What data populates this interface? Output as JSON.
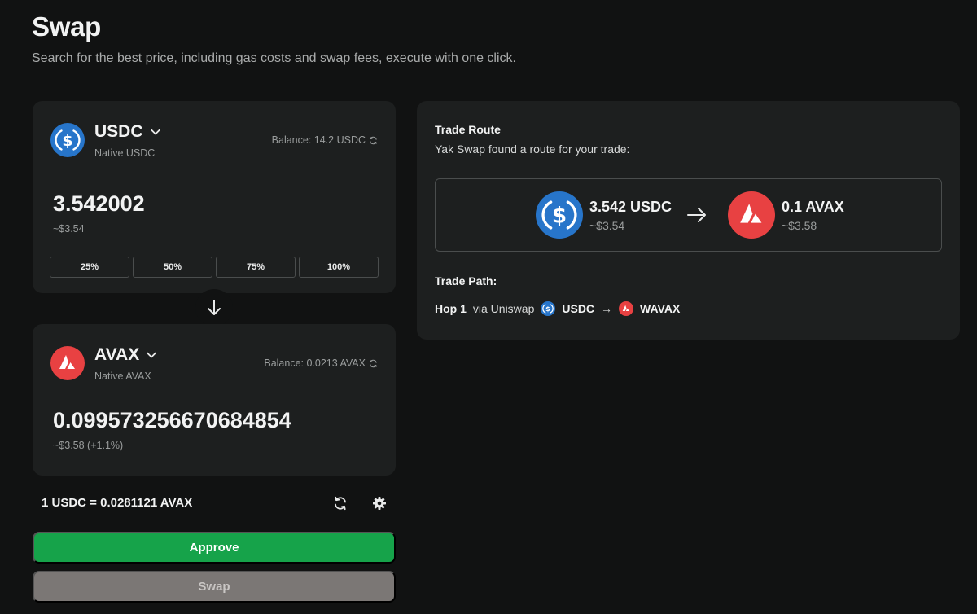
{
  "header": {
    "title": "Swap",
    "subtitle": "Search for the best price, including gas costs and swap fees, execute with one click."
  },
  "from": {
    "symbol": "USDC",
    "name": "Native USDC",
    "balance": "Balance: 14.2 USDC",
    "amount": "3.542002",
    "usd": "~$3.54",
    "percent_buttons": [
      "25%",
      "50%",
      "75%",
      "100%"
    ],
    "logo_color": "#2775ca"
  },
  "to": {
    "symbol": "AVAX",
    "name": "Native AVAX",
    "balance": "Balance: 0.0213 AVAX",
    "amount": "0.099573256670684854",
    "usd": "~$3.58 (+1.1%)",
    "logo_color": "#e84142"
  },
  "rate": "1 USDC = 0.0281121 AVAX",
  "buttons": {
    "approve": "Approve",
    "swap": "Swap"
  },
  "route": {
    "title": "Trade Route",
    "description": "Yak Swap found a route for your trade:",
    "from_amount": "3.542 USDC",
    "from_usd": "~$3.54",
    "to_amount": "0.1 AVAX",
    "to_usd": "~$3.58",
    "path_title": "Trade Path:",
    "hop_label": "Hop 1",
    "via": "via Uniswap",
    "path_from": "USDC",
    "path_to": "WAVAX",
    "path_arrow": "→"
  },
  "colors": {
    "approve": "#16a34a",
    "swap_disabled": "#7b7775",
    "card": "#1d1f1f",
    "background": "#111212"
  },
  "icons": [
    "usdc-logo",
    "avax-logo",
    "chevron-down-icon",
    "refresh-icon",
    "arrow-down-icon",
    "arrow-right-icon",
    "gear-icon"
  ]
}
